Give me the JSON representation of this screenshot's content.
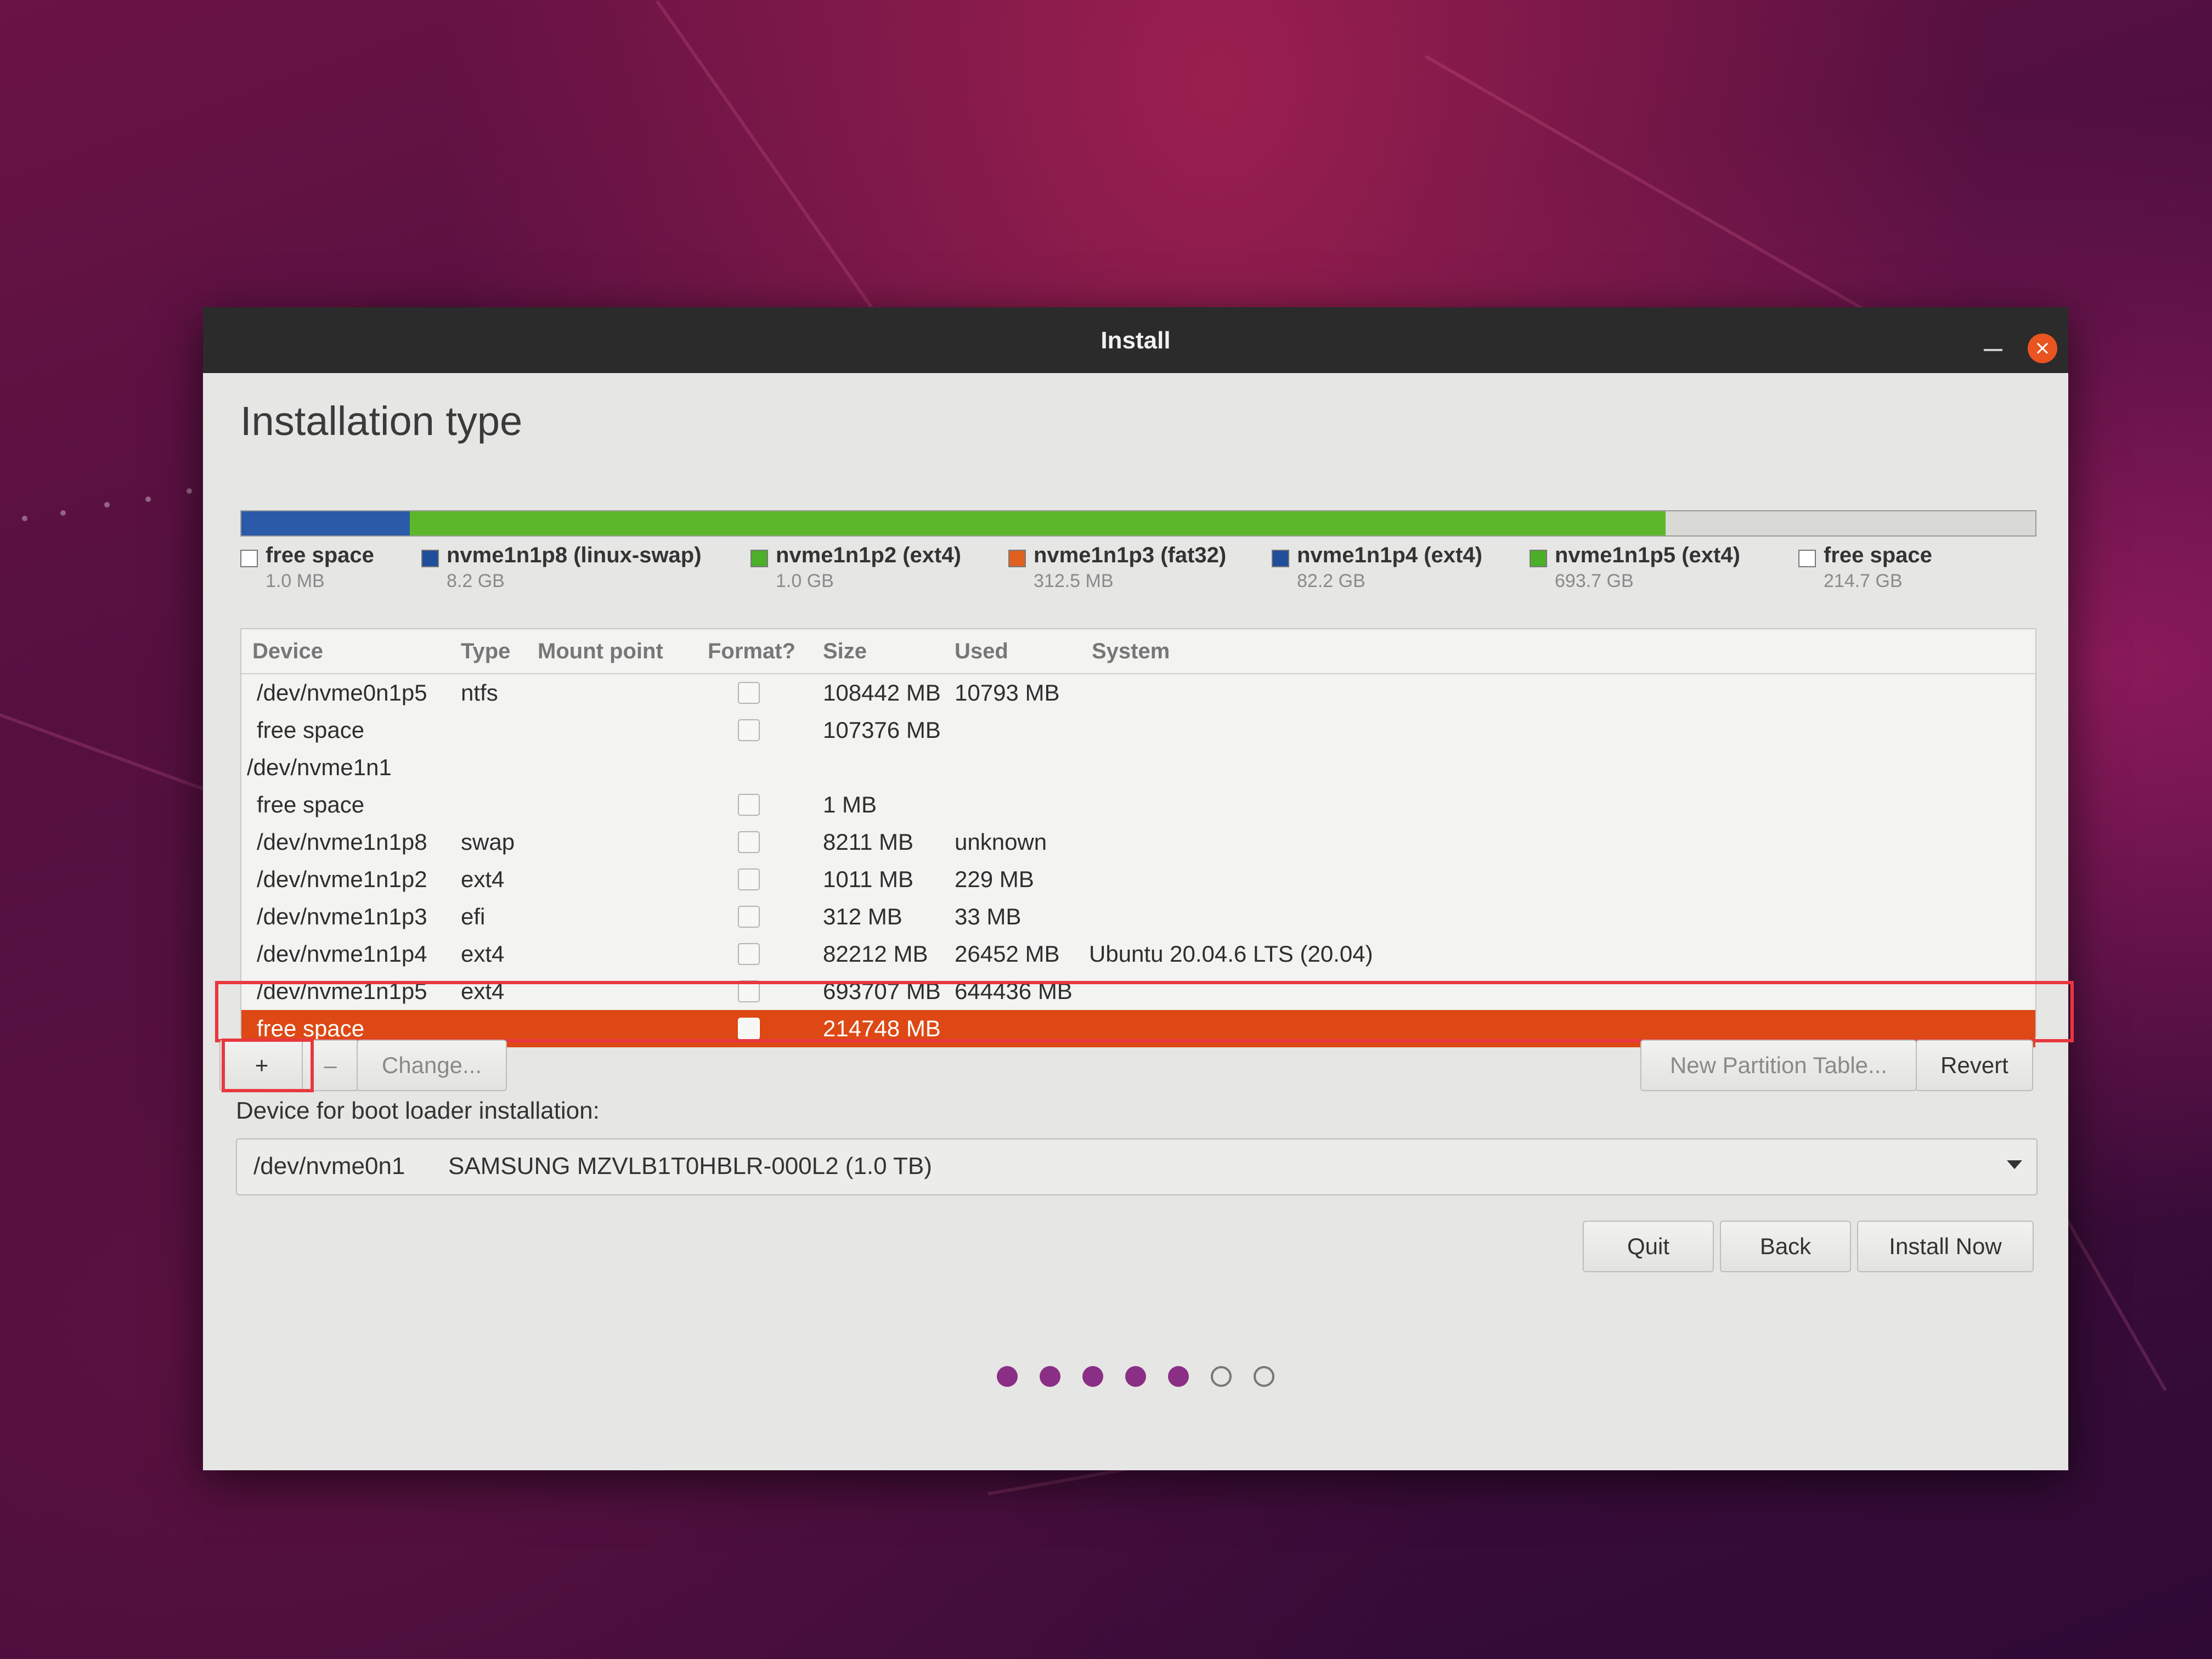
{
  "window": {
    "title": "Install"
  },
  "page_title": "Installation type",
  "partition_bar": [
    {
      "color": "#2a5aa8",
      "fraction": 0.004
    },
    {
      "color": "#2a5aa8",
      "fraction": 0.09
    },
    {
      "color": "#5cb82a",
      "fraction": 0.7
    },
    {
      "color": "#d9d9d6",
      "fraction": 0.206
    }
  ],
  "legend": [
    {
      "name": "free space",
      "size": "1.0 MB",
      "color": "#ffffff"
    },
    {
      "name": "nvme1n1p8 (linux-swap)",
      "size": "8.2 GB",
      "color": "#1f4f9a"
    },
    {
      "name": "nvme1n1p2 (ext4)",
      "size": "1.0 GB",
      "color": "#4caf2a"
    },
    {
      "name": "nvme1n1p3 (fat32)",
      "size": "312.5 MB",
      "color": "#e06020"
    },
    {
      "name": "nvme1n1p4 (ext4)",
      "size": "82.2 GB",
      "color": "#1f4f9a"
    },
    {
      "name": "nvme1n1p5 (ext4)",
      "size": "693.7 GB",
      "color": "#4caf2a"
    },
    {
      "name": "free space",
      "size": "214.7 GB",
      "color": "#ffffff"
    }
  ],
  "table": {
    "headers": {
      "device": "Device",
      "type": "Type",
      "mount": "Mount point",
      "format": "Format?",
      "size": "Size",
      "used": "Used",
      "system": "System"
    },
    "rows": [
      {
        "device": "/dev/nvme0n1p5",
        "type": "ntfs",
        "size": "108442 MB",
        "used": "10793 MB",
        "system": "",
        "check": true,
        "indent": 1
      },
      {
        "device": "free space",
        "type": "",
        "size": "107376 MB",
        "used": "",
        "system": "",
        "check": true,
        "indent": 1
      },
      {
        "device": "/dev/nvme1n1",
        "type": "",
        "size": "",
        "used": "",
        "system": "",
        "check": false,
        "indent": 0
      },
      {
        "device": "free space",
        "type": "",
        "size": "1 MB",
        "used": "",
        "system": "",
        "check": true,
        "indent": 1
      },
      {
        "device": "/dev/nvme1n1p8",
        "type": "swap",
        "size": "8211 MB",
        "used": "unknown",
        "system": "",
        "check": true,
        "indent": 1
      },
      {
        "device": "/dev/nvme1n1p2",
        "type": "ext4",
        "size": "1011 MB",
        "used": "229 MB",
        "system": "",
        "check": true,
        "indent": 1
      },
      {
        "device": "/dev/nvme1n1p3",
        "type": "efi",
        "size": "312 MB",
        "used": "33 MB",
        "system": "",
        "check": true,
        "indent": 1
      },
      {
        "device": "/dev/nvme1n1p4",
        "type": "ext4",
        "size": "82212 MB",
        "used": "26452 MB",
        "system": "Ubuntu 20.04.6 LTS (20.04)",
        "check": true,
        "indent": 1
      },
      {
        "device": "/dev/nvme1n1p5",
        "type": "ext4",
        "size": "693707 MB",
        "used": "644436 MB",
        "system": "",
        "check": true,
        "indent": 1
      },
      {
        "device": "free space",
        "type": "",
        "size": "214748 MB",
        "used": "",
        "system": "",
        "check": true,
        "indent": 1,
        "selected": true
      }
    ]
  },
  "toolbar": {
    "add": "+",
    "remove": "–",
    "change": "Change...",
    "new_table": "New Partition Table...",
    "revert": "Revert"
  },
  "boot_loader": {
    "label": "Device for boot loader installation:",
    "device": "/dev/nvme0n1",
    "model": "SAMSUNG MZVLB1T0HBLR-000L2 (1.0 TB)"
  },
  "buttons": {
    "quit": "Quit",
    "back": "Back",
    "install": "Install Now"
  },
  "progress": {
    "done": 5,
    "total": 7
  }
}
